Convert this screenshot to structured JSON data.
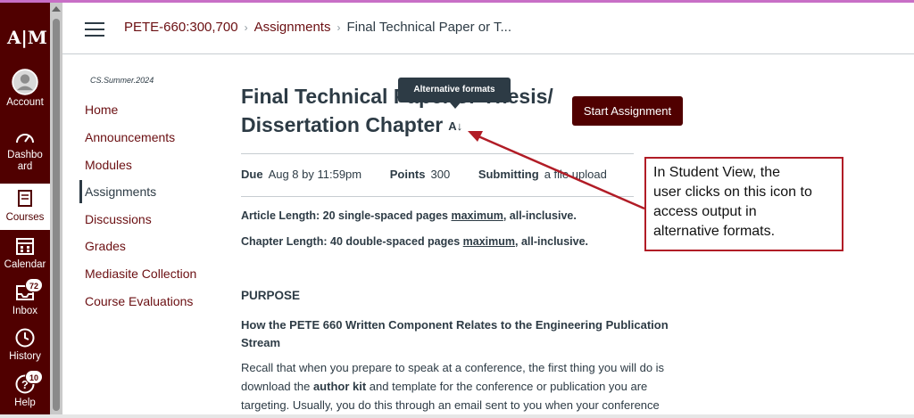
{
  "global_nav": {
    "logo_text": "A|M",
    "items": [
      {
        "label": "Account",
        "icon": "avatar-icon"
      },
      {
        "label": "Dashboard",
        "icon": "dashboard-icon"
      },
      {
        "label": "Courses",
        "icon": "courses-icon"
      },
      {
        "label": "Calendar",
        "icon": "calendar-icon"
      },
      {
        "label": "Inbox",
        "icon": "inbox-icon",
        "badge": "72"
      },
      {
        "label": "History",
        "icon": "clock-icon"
      },
      {
        "label": "Help",
        "icon": "help-icon",
        "badge": "10"
      }
    ]
  },
  "breadcrumb": {
    "course": "PETE-660:300,700",
    "section": "Assignments",
    "current": "Final Technical Paper or T..."
  },
  "course_nav": {
    "term": "CS.Summer.2024",
    "items": [
      "Home",
      "Announcements",
      "Modules",
      "Assignments",
      "Discussions",
      "Grades",
      "Mediasite Collection",
      "Course Evaluations"
    ],
    "active": "Assignments"
  },
  "assignment": {
    "title_line1": "Final Technical Paper or Thesis/",
    "title_line2": "Dissertation Chapter",
    "alt_icon_glyph": "A↓",
    "tooltip": "Alternative formats",
    "start_button": "Start Assignment",
    "due_label": "Due",
    "due_value": "Aug 8 by 11:59pm",
    "points_label": "Points",
    "points_value": "300",
    "submitting_label": "Submitting",
    "submitting_value": "a file upload",
    "article_prefix": "Article Length: 20 single-spaced pages ",
    "article_emph": "maximum",
    "article_suffix": ", all-inclusive.",
    "chapter_prefix": "Chapter Length: 40 double-spaced pages ",
    "chapter_emph": "maximum",
    "chapter_suffix": ", all-inclusive.",
    "purpose_heading": "PURPOSE",
    "subheading_line1": "How the PETE 660 Written Component Relates to the Engineering Publication",
    "subheading_line2": "Stream",
    "body_line1": "Recall that when you prepare to speak at a conference, the first thing you will do is",
    "body_line2_a": "download the ",
    "body_line2_b": "author kit",
    "body_line2_c": " and template for the conference or publication you are",
    "body_line3": "targeting. Usually, you do this through an email sent to you when your conference"
  },
  "annotation": {
    "line1": "In Student View, the",
    "line2": "user clicks on this icon to",
    "line3": "access output in",
    "line4": "alternative formats.",
    "color": "#b11c26"
  },
  "colors": {
    "brand": "#500000",
    "link": "#6b0f12",
    "text": "#2d3b45"
  }
}
